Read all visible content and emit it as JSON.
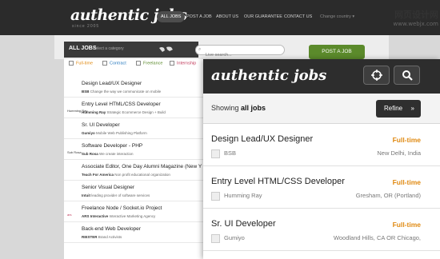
{
  "site": {
    "logo": "authentic jobs",
    "logo_sub": "since 2005"
  },
  "nav": [
    {
      "label": "ALL JOBS",
      "active": true
    },
    {
      "label": "POST A JOB",
      "active": false
    },
    {
      "label": "ABOUT US",
      "active": false
    },
    {
      "label": "OUR GUARANTEE",
      "active": false
    },
    {
      "label": "CONTACT US",
      "active": false
    },
    {
      "label": "Change country ▾",
      "active": false
    }
  ],
  "watermark": {
    "line1": "网页设计网",
    "line2": "www.webjx.com"
  },
  "jobsbar": {
    "label": "ALL JOBS",
    "select_placeholder": "Select a category"
  },
  "search": {
    "placeholder": "Live search..."
  },
  "post_job": "POST A JOB",
  "filters": [
    {
      "label": "Full-time",
      "color": "#e08a12"
    },
    {
      "label": "Contract",
      "color": "#2a7bbf"
    },
    {
      "label": "Freelance",
      "color": "#5b8a2b"
    },
    {
      "label": "Internship",
      "color": "#c0395a"
    }
  ],
  "desktop_jobs": [
    {
      "title": "Design Lead/UX Designer",
      "company": "BSB",
      "desc": "Change the way we communicate on mobile",
      "logo": ""
    },
    {
      "title": "Entry Level HTML/CSS Developer",
      "company": "Humming Ray",
      "desc": "Strategic Ecommerce Design + Build",
      "logo": "Humming Ray"
    },
    {
      "title": "Sr. UI Developer",
      "company": "Gumiyo",
      "desc": "Mobile Web Publishing Platform",
      "logo": ""
    },
    {
      "title": "Software Developer - PHP",
      "company": "Sub Rosa",
      "desc": "We create interaction",
      "logo": "Sub Rosa"
    },
    {
      "title": "Associate Editor, One Day Alumni Magazine (New Y",
      "company": "Teach For America",
      "desc": "Non profit educational organization",
      "logo": ""
    },
    {
      "title": "Senior Visual Designer",
      "company": "Intuit",
      "desc": "leading provider of software services",
      "logo": ""
    },
    {
      "title": "Freelance Node / Socket.io Project",
      "company": "ARS Interactive",
      "desc": "Interactive Marketing Agency",
      "logo": "ars"
    },
    {
      "title": "Back-end Web Developer",
      "company": "RIESTER",
      "desc": "Brand Activists",
      "logo": ""
    }
  ],
  "mobile": {
    "logo": "authentic jobs",
    "showing_prefix": "Showing",
    "showing_bold": "all jobs",
    "refine": "Refine",
    "jobs": [
      {
        "title": "Design Lead/UX Designer",
        "type": "Full-time",
        "company": "BSB",
        "location": "New Delhi, India"
      },
      {
        "title": "Entry Level HTML/CSS Developer",
        "type": "Full-time",
        "company": "Humming Ray",
        "location": "Gresham, OR (Portland)"
      },
      {
        "title": "Sr. UI Developer",
        "type": "Full-time",
        "company": "Gumiyo",
        "location": "Woodland Hills, CA OR Chicago,"
      }
    ]
  }
}
